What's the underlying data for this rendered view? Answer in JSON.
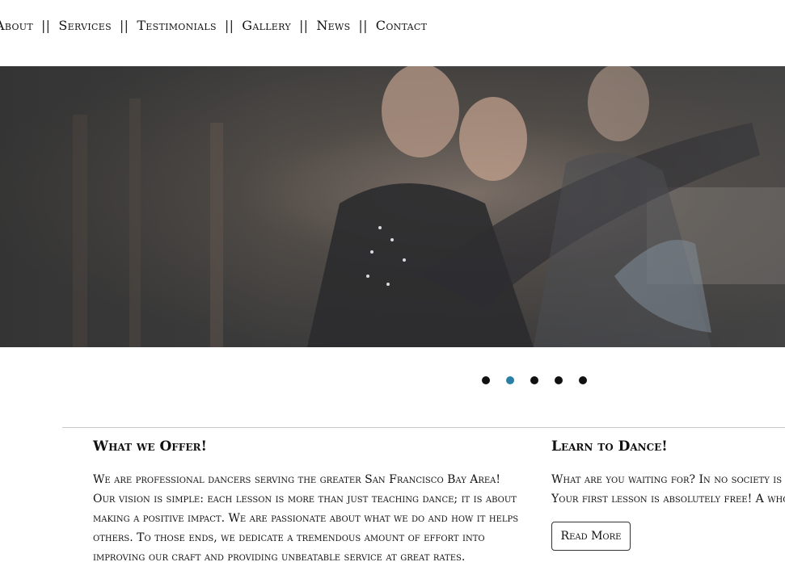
{
  "nav": {
    "items": [
      "About",
      "Services",
      "Testimonials",
      "Gallery",
      "News",
      "Contact"
    ],
    "separator": "||"
  },
  "hero": {
    "image": "ballroom-dancers-photo"
  },
  "slider": {
    "slide_count": 5,
    "active_index": 1,
    "active_color": "#2a7fa6"
  },
  "offer": {
    "title": "What we Offer!",
    "text": "We are professional dancers serving the greater San Francisco Bay Area! Our vision is simple: each lesson is more than just teaching dance; it is about making a positive impact. We are passionate about what we do and how it helps others. To those ends, we dedicate a tremendous amount of effort into improving our craft and providing unbeatable service at great rates."
  },
  "learn": {
    "title": "Learn to Dance!",
    "text": "What are you waiting for? In no society is k",
    "text2": "Your first lesson is absolutely free! A whol",
    "button": "Read More"
  }
}
